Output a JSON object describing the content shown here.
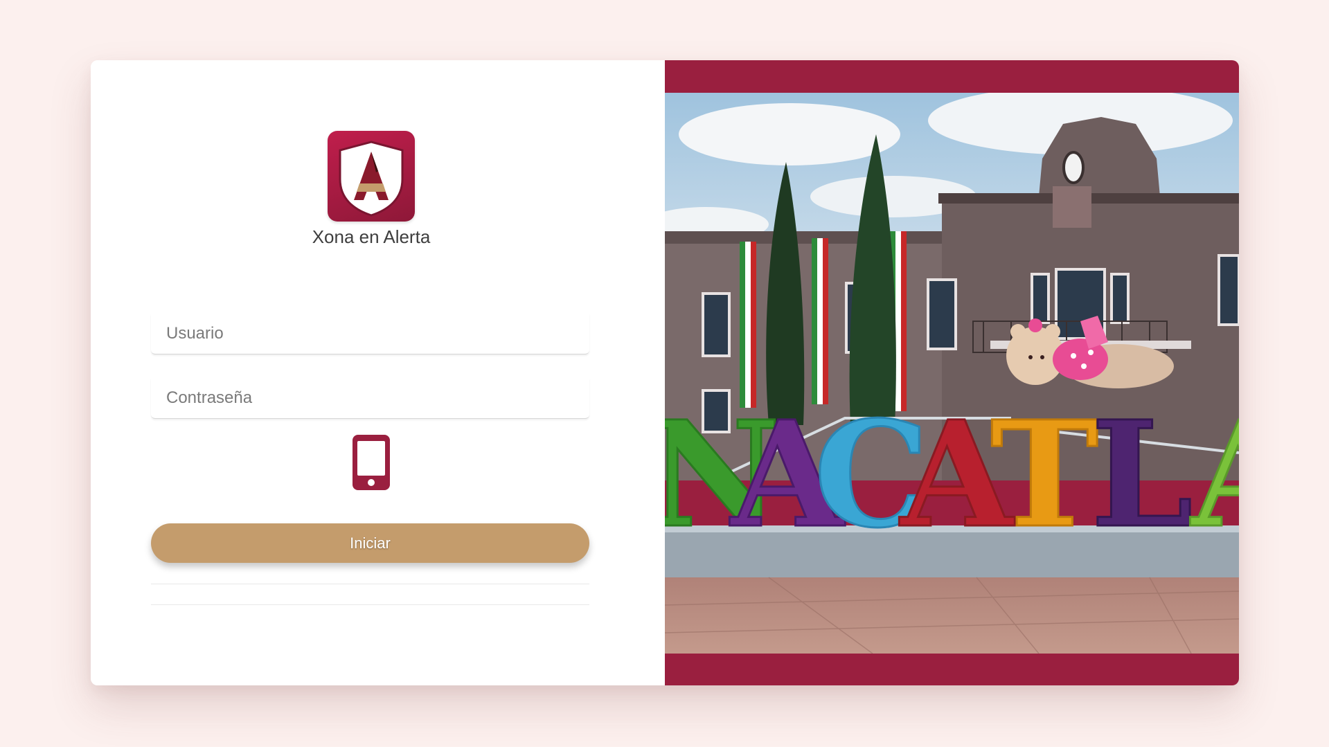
{
  "app": {
    "name": "Xona en Alerta",
    "logo_letter": "A"
  },
  "form": {
    "username_placeholder": "Usuario",
    "password_placeholder": "Contraseña",
    "submit_label": "Iniciar"
  },
  "icons": {
    "app_logo": "shield-a-logo",
    "device": "smartphone-icon"
  },
  "photo": {
    "sign_letters": [
      "N",
      "A",
      "C",
      "A",
      "T",
      "L",
      "A"
    ]
  },
  "colors": {
    "brand_primary": "#9a1f3f",
    "button": "#c49c6c",
    "page_background": "#fcf0ee"
  }
}
